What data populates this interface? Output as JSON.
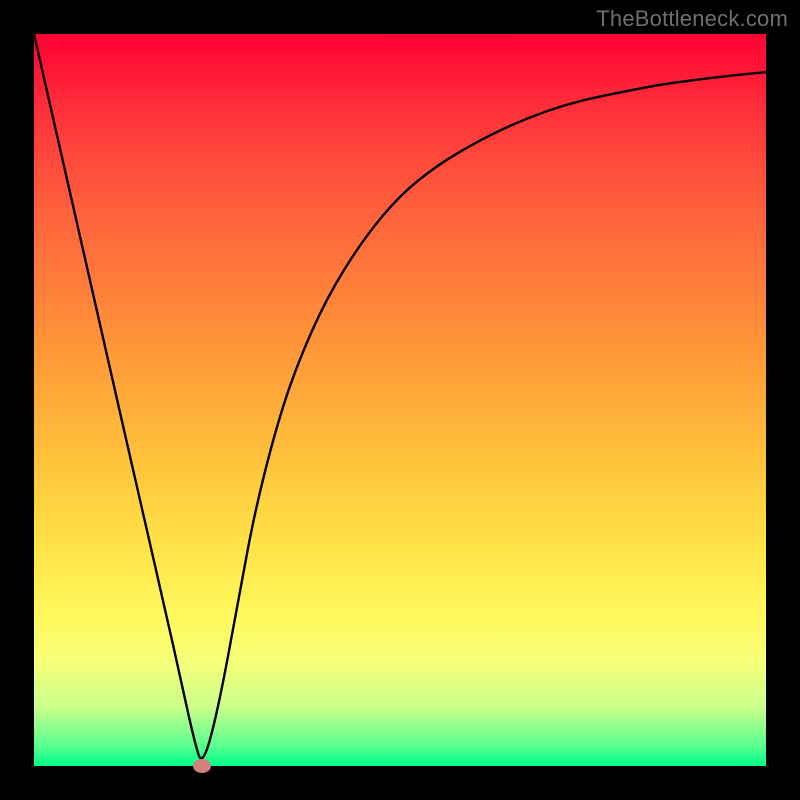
{
  "watermark": "TheBottleneck.com",
  "colors": {
    "frame": "#000000",
    "curve": "#000000",
    "marker": "#d37f7c",
    "gradient_top": "#ff0033",
    "gradient_bottom": "#00ff88"
  },
  "chart_data": {
    "type": "line",
    "title": "",
    "xlabel": "",
    "ylabel": "",
    "xlim": [
      0,
      100
    ],
    "ylim": [
      0,
      100
    ],
    "grid": false,
    "legend": false,
    "series": [
      {
        "name": "bottleneck-curve",
        "x": [
          0,
          5,
          10,
          15,
          18,
          20,
          22,
          23,
          25,
          28,
          30,
          33,
          36,
          40,
          45,
          50,
          55,
          60,
          65,
          70,
          75,
          80,
          85,
          90,
          95,
          100
        ],
        "y": [
          100,
          78,
          56,
          34,
          21,
          12,
          3,
          0,
          7,
          23,
          34,
          46,
          55,
          64,
          72,
          78,
          82,
          85,
          87.5,
          89.5,
          91,
          92,
          93,
          93.7,
          94.3,
          94.8
        ]
      }
    ],
    "annotations": [
      {
        "name": "minimum-marker",
        "x": 23,
        "y": 0
      }
    ]
  }
}
